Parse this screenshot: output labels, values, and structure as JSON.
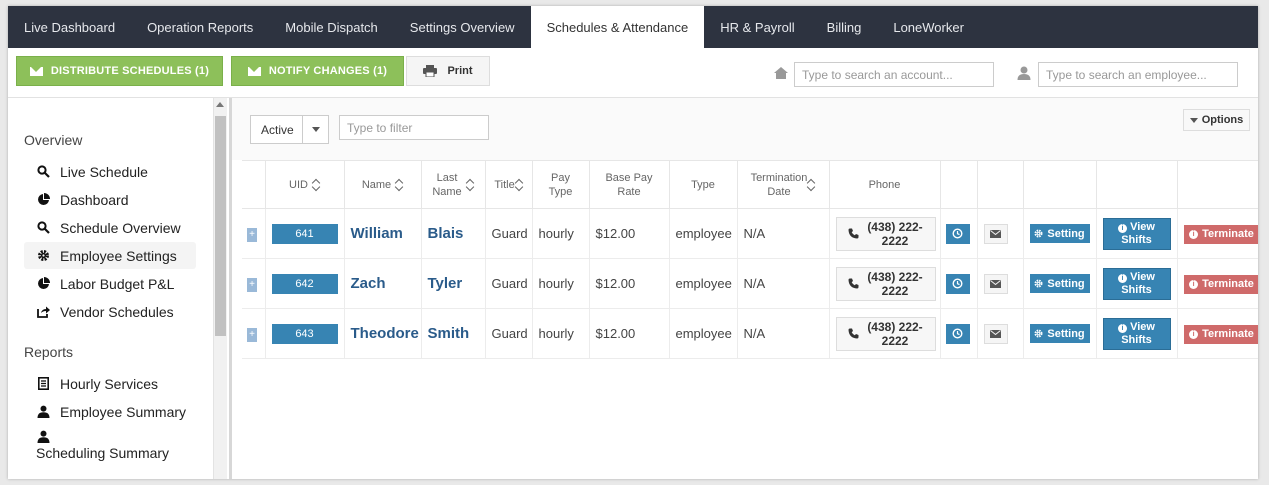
{
  "nav": {
    "tabs": [
      {
        "label": "Live Dashboard"
      },
      {
        "label": "Operation Reports"
      },
      {
        "label": "Mobile Dispatch"
      },
      {
        "label": "Settings Overview"
      },
      {
        "label": "Schedules & Attendance"
      },
      {
        "label": "HR & Payroll"
      },
      {
        "label": "Billing"
      },
      {
        "label": "LoneWorker"
      }
    ],
    "active": "Schedules & Attendance"
  },
  "toolbar": {
    "distribute_label": "DISTRIBUTE SCHEDULES (1)",
    "notify_label": "NOTIFY CHANGES (1)",
    "print_label": "Print",
    "account_search_placeholder": "Type to search an account...",
    "employee_search_placeholder": "Type to search an employee...",
    "accent_green": "#8dc05a"
  },
  "sidebar": {
    "overview_heading": "Overview",
    "overview_items": [
      {
        "label": "Live Schedule",
        "icon": "search-icon"
      },
      {
        "label": "Dashboard",
        "icon": "pie-chart-icon"
      },
      {
        "label": "Schedule Overview",
        "icon": "search-icon"
      },
      {
        "label": "Employee Settings",
        "icon": "gear-icon"
      },
      {
        "label": "Labor Budget P&L",
        "icon": "pie-chart-icon"
      },
      {
        "label": "Vendor Schedules",
        "icon": "share-icon"
      }
    ],
    "reports_heading": "Reports",
    "reports_items": [
      {
        "label": "Hourly Services",
        "icon": "document-icon"
      },
      {
        "label": "Employee Summary",
        "icon": "user-icon"
      },
      {
        "label": "Scheduling Summary",
        "icon": "user-icon"
      }
    ]
  },
  "filters": {
    "status_value": "Active",
    "filter_placeholder": "Type to filter",
    "options_label": "Options"
  },
  "table": {
    "headers": {
      "uid": "UID",
      "name": "Name",
      "last_name_1": "Last",
      "last_name_2": "Name",
      "title": "Title",
      "pay_type_1": "Pay",
      "pay_type_2": "Type",
      "base_pay_1": "Base Pay",
      "base_pay_2": "Rate",
      "type": "Type",
      "termination_1": "Termination",
      "termination_2": "Date",
      "phone": "Phone"
    },
    "rows": [
      {
        "uid": "641",
        "name": "William",
        "last_name": "Blais",
        "title": "Guard",
        "pay_type": "hourly",
        "base_pay": "$12.00",
        "type": "employee",
        "termination": "N/A",
        "phone_1": "(438) 222-",
        "phone_2": "2222"
      },
      {
        "uid": "642",
        "name": "Zach",
        "last_name": "Tyler",
        "title": "Guard",
        "pay_type": "hourly",
        "base_pay": "$12.00",
        "type": "employee",
        "termination": "N/A",
        "phone_1": "(438) 222-",
        "phone_2": "2222"
      },
      {
        "uid": "643",
        "name": "Theodore",
        "last_name": "Smith",
        "title": "Guard",
        "pay_type": "hourly",
        "base_pay": "$12.00",
        "type": "employee",
        "termination": "N/A",
        "phone_1": "(438) 222-",
        "phone_2": "2222"
      }
    ],
    "expand_symbol": "+",
    "setting_label": "Setting",
    "view_shifts_1": "View",
    "view_shifts_2": "Shifts",
    "terminate_label": "Terminate",
    "info_glyph": "i"
  }
}
